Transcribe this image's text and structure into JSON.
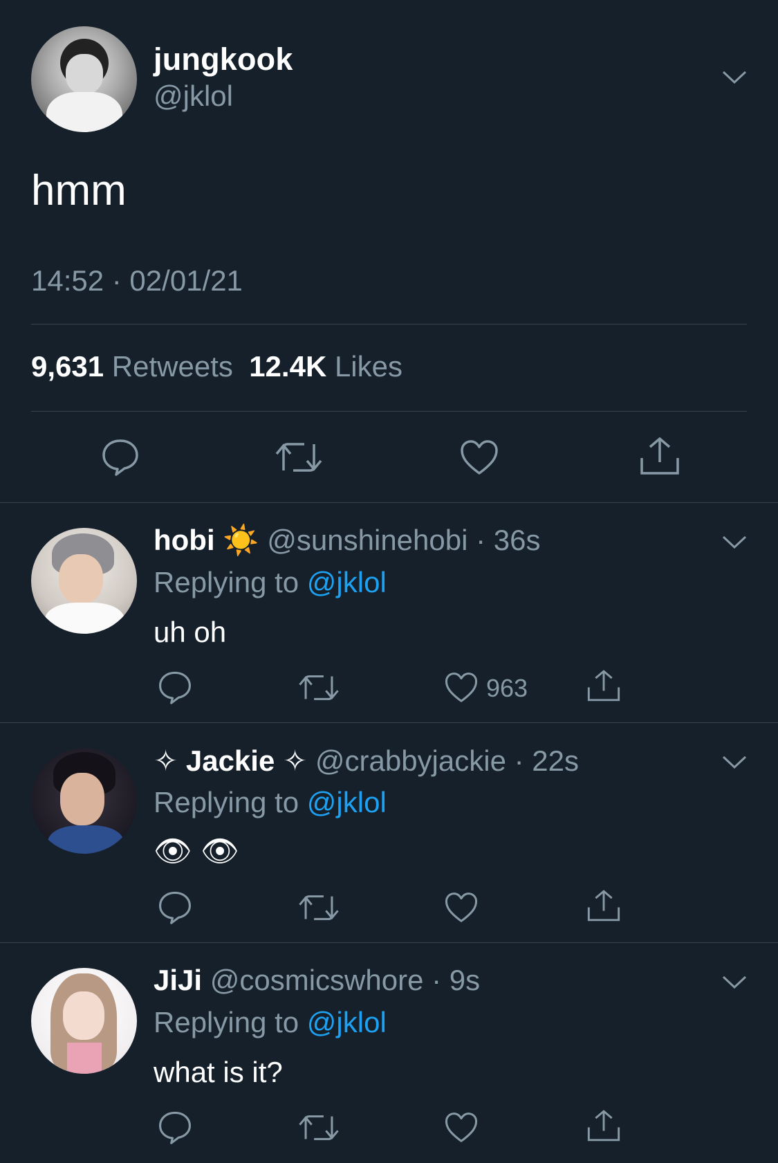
{
  "main_tweet": {
    "display_name": "jungkook",
    "handle": "@jklol",
    "text": "hmm",
    "timestamp": "14:52 · 02/01/21",
    "retweet_count": "9,631",
    "retweet_label": "Retweets",
    "like_count": "12.4K",
    "like_label": "Likes"
  },
  "replies": [
    {
      "display_name": "hobi",
      "name_emoji": "☀️",
      "handle": "@sunshinehobi",
      "time": "· 36s",
      "replying_prefix": "Replying to",
      "replying_to": "@jklol",
      "text": "uh oh",
      "like_count": "963"
    },
    {
      "display_name": "✧ Jackie ✧",
      "handle": "@crabbyjackie",
      "time": "· 22s",
      "replying_prefix": "Replying to",
      "replying_to": "@jklol",
      "text": "👁 👁",
      "like_count": ""
    },
    {
      "display_name": "JiJi",
      "handle": "@cosmicswhore",
      "time": "· 9s",
      "replying_prefix": "Replying to",
      "replying_to": "@jklol",
      "text": "what is it?",
      "like_count": ""
    }
  ],
  "colors": {
    "background": "#15202b",
    "secondary_text": "#8899a6",
    "link": "#1da1f2",
    "divider": "#38444d"
  },
  "icons": [
    "chevron-down-icon",
    "reply-icon",
    "retweet-icon",
    "like-icon",
    "share-icon"
  ]
}
